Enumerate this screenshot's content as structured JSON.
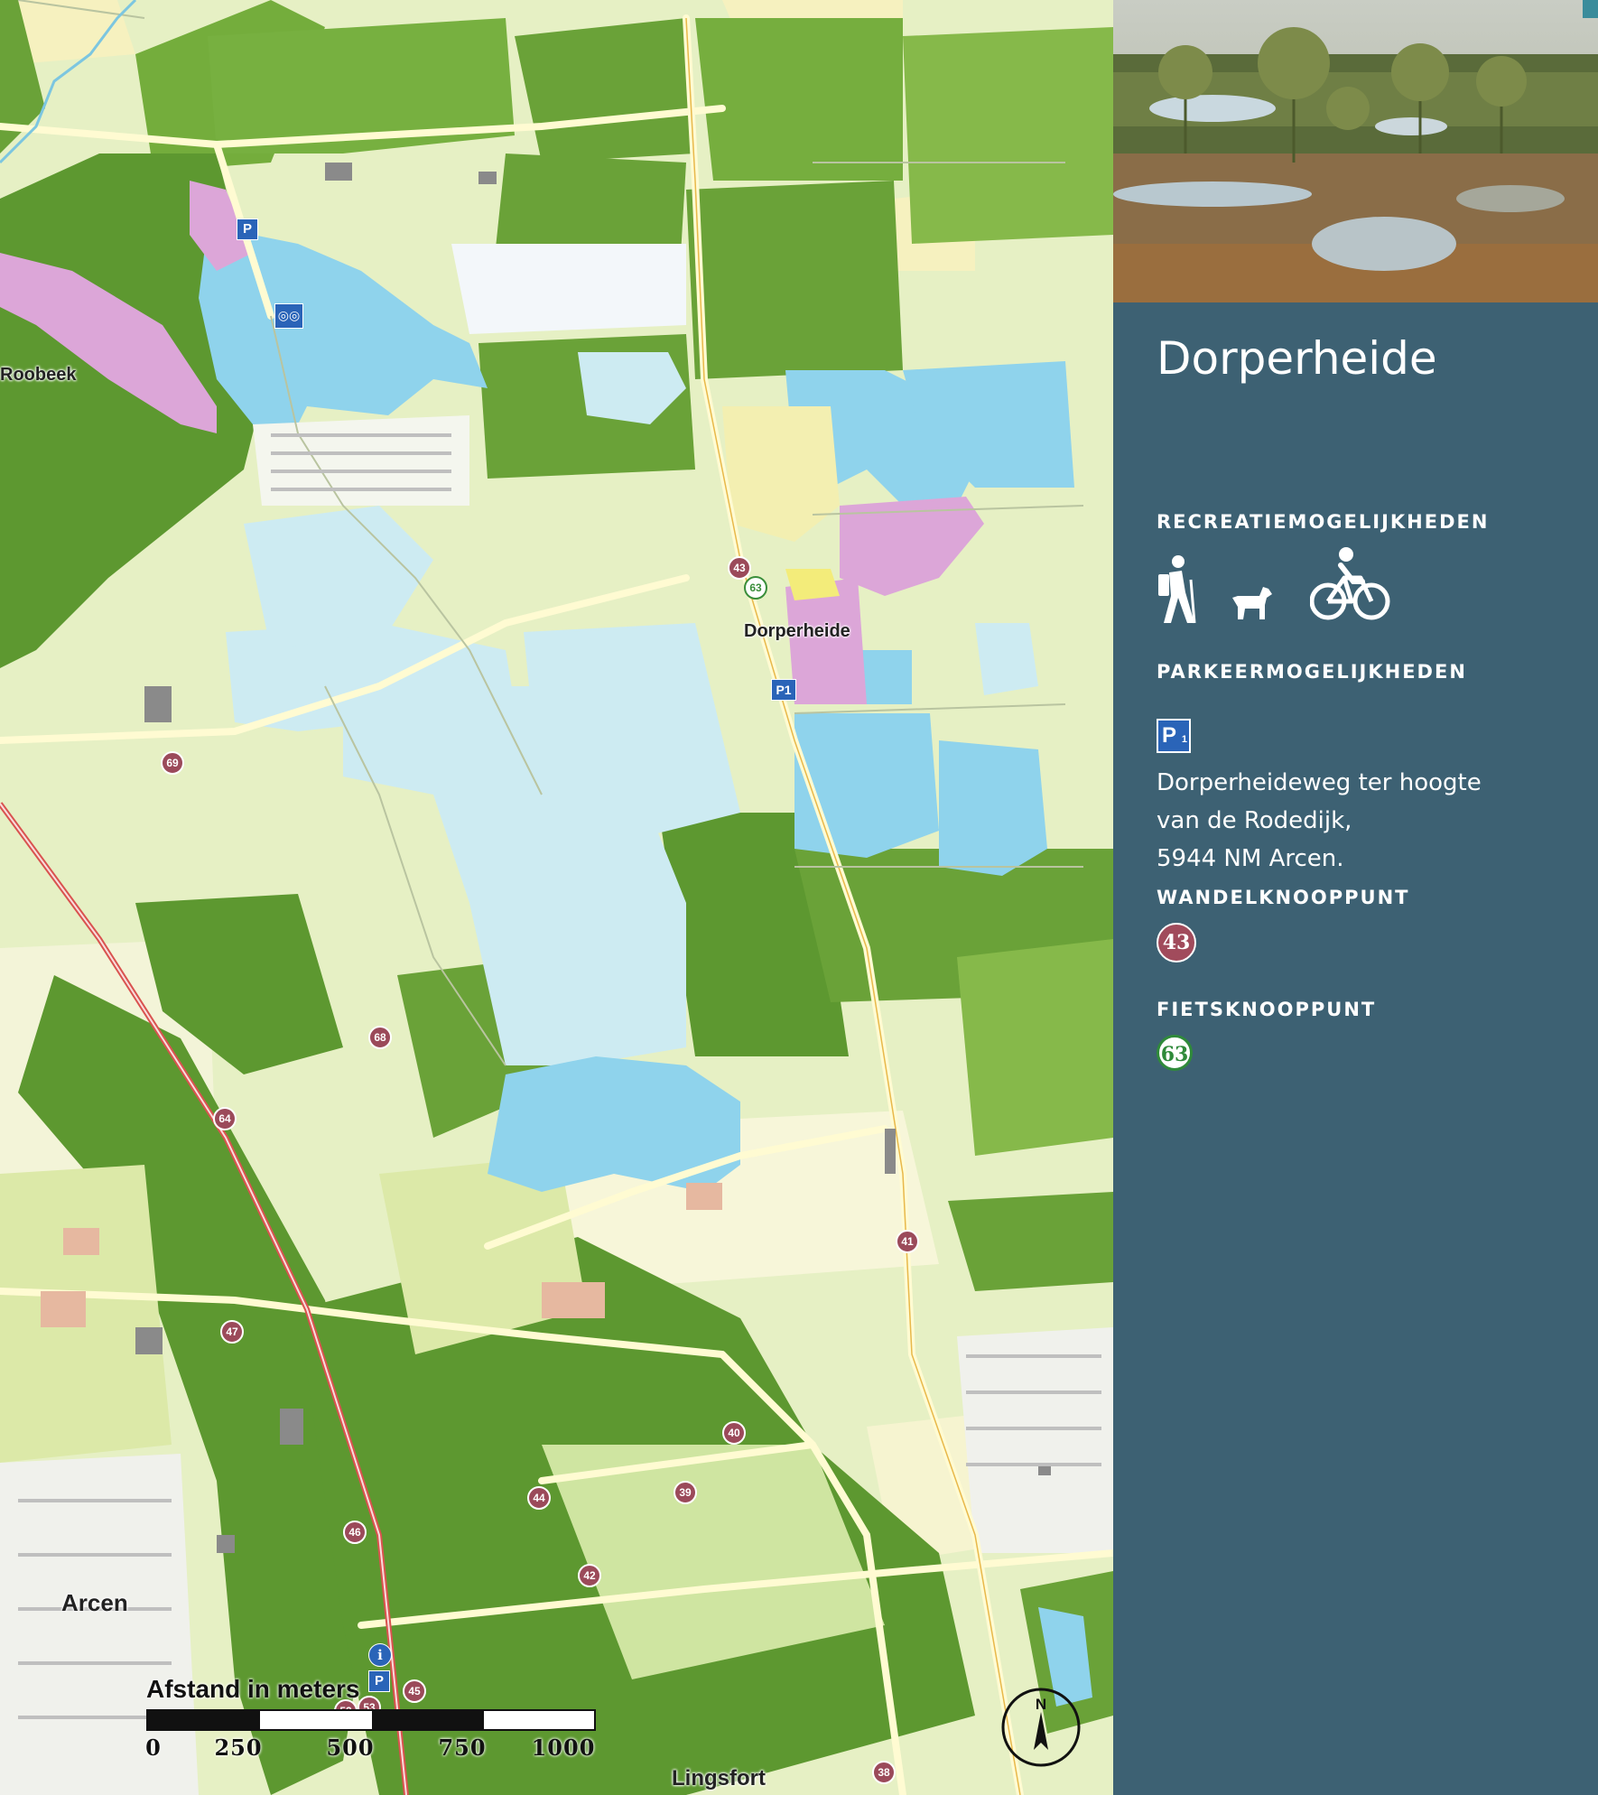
{
  "map": {
    "place_labels": {
      "roobeek": "Roobeek",
      "dorperheide": "Dorperheide",
      "arcen": "Arcen",
      "lingsfort": "Lingsfort"
    },
    "parking_labels": {
      "p": "P",
      "p1": "P1"
    },
    "info_label": "i",
    "compass_label": "N",
    "walk_nodes": [
      "43",
      "69",
      "68",
      "64",
      "47",
      "46",
      "44",
      "42",
      "40",
      "39",
      "41",
      "45",
      "52",
      "53",
      "38"
    ],
    "bike_nodes": [
      "63"
    ],
    "scale": {
      "title": "Afstand in meters",
      "ticks": [
        "0",
        "250",
        "500",
        "750",
        "1000"
      ]
    },
    "colors": {
      "water": "#8fd3ec",
      "pale_water": "#cdebf2",
      "forest": "#6ea737",
      "meadow": "#cfe5a1",
      "heath": "#dca6d8",
      "field": "#f5f3c9",
      "walk_node": "#9b4a5a",
      "bike_node": "#3a8e3a",
      "parking": "#2a64b8"
    }
  },
  "panel": {
    "title": "Dorperheide",
    "recreation_heading": "RECREATIEMOGELIJKHEDEN",
    "recreation_icons": [
      "hiker-icon",
      "dog-icon",
      "cyclist-icon"
    ],
    "parking_heading": "PARKEERMOGELIJKHEDEN",
    "parking_symbol": "P",
    "parking_symbol_sub": "1",
    "parking_address": [
      "Dorperheideweg ter hoogte",
      "van de Rodedijk,",
      "5944 NM Arcen."
    ],
    "walk_heading": "WANDELKNOOPPUNT",
    "walk_node": "43",
    "bike_heading": "FIETSKNOOPPUNT",
    "bike_node": "63",
    "background": "#3d6173"
  }
}
